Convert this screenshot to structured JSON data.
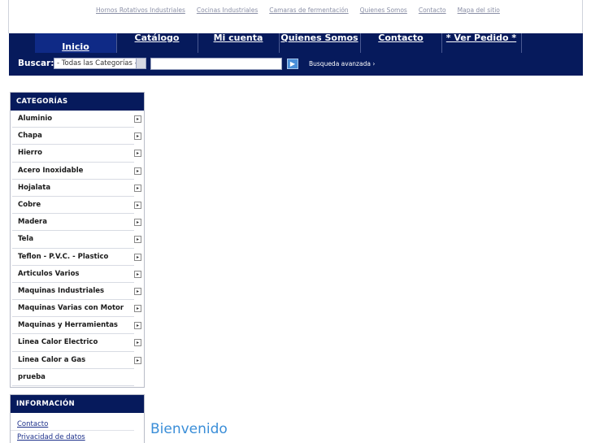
{
  "top_links": [
    "Hornos Rotativos Industriales",
    "Cocinas Industriales",
    "Camaras de fermentación",
    "Quienes Somos",
    "Contacto",
    "Mapa del sitio"
  ],
  "nav": {
    "home": "Inicio",
    "catalog": "Catálogo",
    "account": "Mi cuenta",
    "about": "Quienes Somos",
    "contact": "Contacto",
    "order": "* Ver Pedido *"
  },
  "search": {
    "label": "Buscar:",
    "category_selected": "- Todas las Categorías -",
    "query": "",
    "advanced": "Busqueda avanzada ›"
  },
  "categories": {
    "title": "CATEGORÍAS",
    "items": [
      "Aluminio",
      "Chapa",
      "Hierro",
      "Acero Inoxidable",
      "Hojalata",
      "Cobre",
      "Madera",
      "Tela",
      "Teflon - P.V.C. - Plastico",
      "Articulos Varios",
      "Maquinas Industriales",
      "Maquinas Varias con Motor",
      "Maquinas y Herramientas",
      "Linea Calor Electrico",
      "Linea Calor a Gas",
      "prueba"
    ]
  },
  "information": {
    "title": "INFORMACIÓN",
    "links": [
      "Contacto",
      "Privacidad de datos"
    ]
  },
  "main": {
    "welcome": "Bienvenido"
  }
}
